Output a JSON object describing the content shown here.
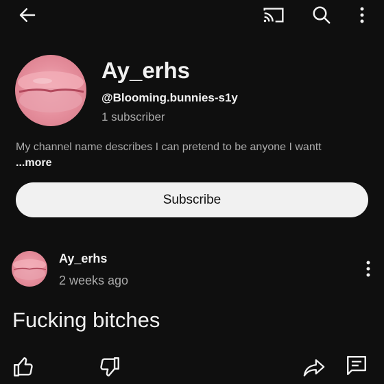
{
  "topbar": {
    "icons": [
      "arrow-left-icon",
      "cast-icon",
      "search-icon",
      "more-vertical-icon"
    ]
  },
  "channel": {
    "name": "Ay_erhs",
    "handle": "@Blooming.bunnies-s1y",
    "subscribers": "1 subscriber",
    "description": "My channel name describes I can pretend to be anyone I wantt ",
    "more_label": "...more",
    "subscribe_label": "Subscribe"
  },
  "post": {
    "author": "Ay_erhs",
    "time": "2 weeks ago",
    "text": "Fucking bitches",
    "actions": [
      "thumb-up-icon",
      "thumb-down-icon",
      "share-icon",
      "comment-icon"
    ]
  },
  "colors": {
    "background": "#0f0f0f",
    "text_primary": "#f1f1f1",
    "text_secondary": "#aaaaaa",
    "button_bg": "#f1f1f1",
    "avatar_pink": "#e8909c"
  }
}
